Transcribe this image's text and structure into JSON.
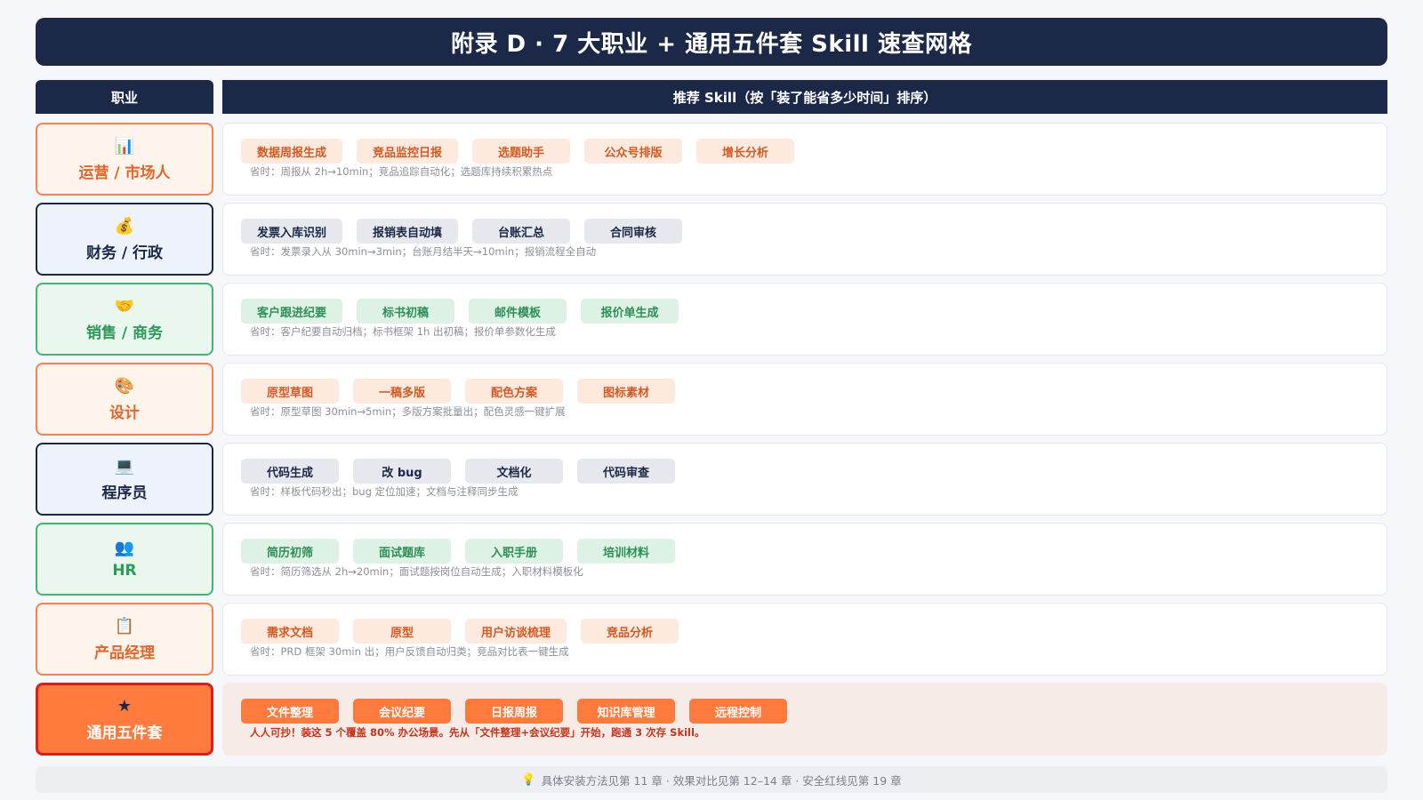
{
  "title": "附录 D · 7 大职业 + 通用五件套 Skill 速查网格",
  "header": {
    "left": "职业",
    "right": "推荐 Skill（按「装了能省多少时间」排序）"
  },
  "rows": [
    {
      "role": "运营 / 市场人",
      "icon": "📊",
      "skills": [
        "数据周报生成",
        "竞品监控日报",
        "选题助手",
        "公众号排版",
        "增长分析"
      ],
      "note": "省时：周报从 2h→10min；竞品追踪自动化；选题库持续积累热点"
    },
    {
      "role": "财务 / 行政",
      "icon": "💰",
      "skills": [
        "发票入库识别",
        "报销表自动填",
        "台账汇总",
        "合同审核"
      ],
      "note": "省时：发票录入从 30min→3min；台账月结半天→10min；报销流程全自动"
    },
    {
      "role": "销售 / 商务",
      "icon": "🤝",
      "skills": [
        "客户跟进纪要",
        "标书初稿",
        "邮件模板",
        "报价单生成"
      ],
      "note": "省时：客户纪要自动归档；标书框架 1h 出初稿；报价单参数化生成"
    },
    {
      "role": "设计",
      "icon": "🎨",
      "skills": [
        "原型草图",
        "一稿多版",
        "配色方案",
        "图标素材"
      ],
      "note": "省时：原型草图 30min→5min；多版方案批量出；配色灵感一键扩展"
    },
    {
      "role": "程序员",
      "icon": "💻",
      "skills": [
        "代码生成",
        "改 bug",
        "文档化",
        "代码审查"
      ],
      "note": "省时：样板代码秒出；bug 定位加速；文档与注释同步生成"
    },
    {
      "role": "HR",
      "icon": "👥",
      "skills": [
        "简历初筛",
        "面试题库",
        "入职手册",
        "培训材料"
      ],
      "note": "省时：简历筛选从 2h→20min；面试题按岗位自动生成；入职材料模板化"
    },
    {
      "role": "产品经理",
      "icon": "📋",
      "skills": [
        "需求文档",
        "原型",
        "用户访谈梳理",
        "竞品分析"
      ],
      "note": "省时：PRD 框架 30min 出；用户反馈自动归类；竞品对比表一键生成"
    },
    {
      "role": "通用五件套",
      "icon": "★",
      "skills": [
        "文件整理",
        "会议纪要",
        "日报周报",
        "知识库管理",
        "远程控制"
      ],
      "note": "人人可抄！装这 5 个覆盖 80% 办公场景。先从「文件整理+会议纪要」开始，跑通 3 次存 Skill。"
    }
  ],
  "footer": "具体安装方法见第 11 章 · 效果对比见第 12–14 章 · 安全红线见第 19 章",
  "colors": {
    "navy": "#1b2847",
    "orange": "#f3824f",
    "green": "#3fb56f",
    "accent": "#ff7a3d",
    "red": "#d91e1e"
  }
}
